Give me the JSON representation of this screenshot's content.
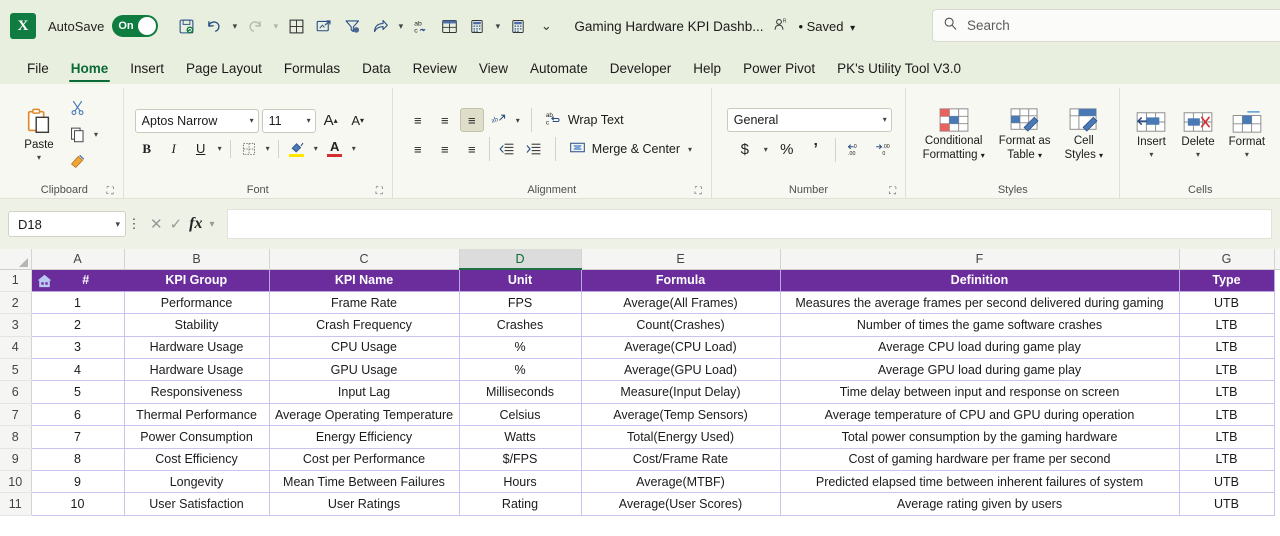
{
  "titlebar": {
    "app_logo": "X",
    "autosave_label": "AutoSave",
    "autosave_state": "On",
    "quick_access": [
      {
        "name": "save-icon",
        "glyph": "⎗"
      },
      {
        "name": "undo-icon",
        "glyph": "↶"
      },
      {
        "name": "redo-icon",
        "glyph": "↷"
      },
      {
        "name": "borders-icon",
        "glyph": "⊞"
      },
      {
        "name": "insert-chart-icon",
        "glyph": "↗"
      },
      {
        "name": "filter-icon",
        "glyph": "∇"
      },
      {
        "name": "share-icon",
        "glyph": "➦"
      },
      {
        "name": "spelling-icon",
        "glyph": "ab"
      },
      {
        "name": "pivot-table-icon",
        "glyph": "▦"
      },
      {
        "name": "calculator-icon",
        "glyph": "☷"
      },
      {
        "name": "calculator-2-icon",
        "glyph": "☷"
      },
      {
        "name": "customize-qat-icon",
        "glyph": "⌵"
      }
    ],
    "document_title": "Gaming Hardware KPI Dashb...",
    "person_icon": "⎇",
    "saved_state": "• Saved",
    "search_placeholder": "Search",
    "search_value": ""
  },
  "ribbon_tabs": [
    {
      "label": "File",
      "active": false
    },
    {
      "label": "Home",
      "active": true
    },
    {
      "label": "Insert",
      "active": false
    },
    {
      "label": "Page Layout",
      "active": false
    },
    {
      "label": "Formulas",
      "active": false
    },
    {
      "label": "Data",
      "active": false
    },
    {
      "label": "Review",
      "active": false
    },
    {
      "label": "View",
      "active": false
    },
    {
      "label": "Automate",
      "active": false
    },
    {
      "label": "Developer",
      "active": false
    },
    {
      "label": "Help",
      "active": false
    },
    {
      "label": "Power Pivot",
      "active": false
    },
    {
      "label": "PK's Utility Tool V3.0",
      "active": false
    }
  ],
  "ribbon": {
    "clipboard": {
      "group_label": "Clipboard",
      "paste_label": "Paste",
      "cut_label": "Cut",
      "copy_label": "Copy",
      "format_painter_label": "Format Painter"
    },
    "font": {
      "group_label": "Font",
      "font_name": "Aptos Narrow",
      "font_size": "11",
      "grow_font": "A",
      "shrink_font": "A",
      "bold": "B",
      "italic": "I",
      "underline": "U",
      "borders": "▦",
      "fill_color": "A",
      "font_color": "A"
    },
    "alignment": {
      "group_label": "Alignment",
      "wrap_text_label": "Wrap Text",
      "merge_center_label": "Merge & Center",
      "align_top": "≡",
      "align_middle": "≡",
      "align_bottom": "≡",
      "orientation": "↗",
      "align_left": "≡",
      "align_center": "≡",
      "align_right": "≡",
      "decrease_indent": "←",
      "increase_indent": "→"
    },
    "number": {
      "group_label": "Number",
      "format": "General",
      "currency": "$",
      "percent": "%",
      "comma": ",",
      "decrease_decimal": ".00",
      "increase_decimal": ".00"
    },
    "styles": {
      "group_label": "Styles",
      "conditional_formatting": "Conditional\nFormatting",
      "conditional_formatting_l1": "Conditional",
      "conditional_formatting_l2": "Formatting",
      "format_as_table_l1": "Format as",
      "format_as_table_l2": "Table",
      "cell_styles_l1": "Cell",
      "cell_styles_l2": "Styles"
    },
    "cells": {
      "group_label": "Cells",
      "insert_label": "Insert",
      "delete_label": "Delete",
      "format_label": "Format"
    }
  },
  "formula_bar": {
    "name_box": "D18",
    "cancel_icon": "✕",
    "enter_icon": "✓",
    "fx_label": "fx",
    "formula_value": ""
  },
  "sheet": {
    "column_letters": [
      "A",
      "B",
      "C",
      "D",
      "E",
      "F",
      "G"
    ],
    "selected_column": "D",
    "row_numbers": [
      "1",
      "2",
      "3",
      "4",
      "5",
      "6",
      "7",
      "8",
      "9",
      "10",
      "11"
    ],
    "home_icon": "home-icon",
    "headers": [
      "#",
      "KPI Group",
      "KPI Name",
      "Unit",
      "Formula",
      "Definition",
      "Type"
    ],
    "header_fill": "#6b2d9c",
    "rows": [
      [
        "1",
        "Performance",
        "Frame Rate",
        "FPS",
        "Average(All Frames)",
        "Measures the average frames per second delivered during gaming",
        "UTB"
      ],
      [
        "2",
        "Stability",
        "Crash Frequency",
        "Crashes",
        "Count(Crashes)",
        "Number of times the game software crashes",
        "LTB"
      ],
      [
        "3",
        "Hardware Usage",
        "CPU Usage",
        "%",
        "Average(CPU Load)",
        "Average CPU load during game play",
        "LTB"
      ],
      [
        "4",
        "Hardware Usage",
        "GPU Usage",
        "%",
        "Average(GPU Load)",
        "Average GPU load during game play",
        "LTB"
      ],
      [
        "5",
        "Responsiveness",
        "Input Lag",
        "Milliseconds",
        "Measure(Input Delay)",
        "Time delay between input and response on screen",
        "LTB"
      ],
      [
        "6",
        "Thermal Performance",
        "Average Operating Temperature",
        "Celsius",
        "Average(Temp Sensors)",
        "Average temperature of CPU and GPU during operation",
        "LTB"
      ],
      [
        "7",
        "Power Consumption",
        "Energy Efficiency",
        "Watts",
        "Total(Energy Used)",
        "Total power consumption by the gaming hardware",
        "LTB"
      ],
      [
        "8",
        "Cost Efficiency",
        "Cost per Performance",
        "$/FPS",
        "Cost/Frame Rate",
        "Cost of gaming hardware per frame per second",
        "LTB"
      ],
      [
        "9",
        "Longevity",
        "Mean Time Between Failures",
        "Hours",
        "Average(MTBF)",
        "Predicted elapsed time between inherent failures of system",
        "UTB"
      ],
      [
        "10",
        "User Satisfaction",
        "User Ratings",
        "Rating",
        "Average(User Scores)",
        "Average rating given by users",
        "UTB"
      ]
    ]
  }
}
